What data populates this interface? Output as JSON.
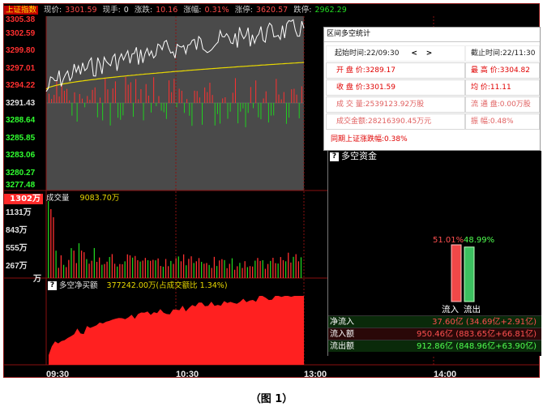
{
  "header": {
    "index_name": "上证指数",
    "now_label": "现价:",
    "now_value": "3301.59",
    "hand_label": "现手:",
    "hand_value": "0",
    "change_label": "涨跌:",
    "change_value": "10.16",
    "pct_label": "涨幅:",
    "pct_value": "0.31%",
    "limit_up_label": "涨停:",
    "limit_up_value": "3620.57",
    "limit_down_label": "跌停:",
    "limit_down_value": "2962.29"
  },
  "price_axis": [
    "3305.38",
    "3302.59",
    "3299.80",
    "3297.01",
    "3294.22",
    "3291.43",
    "3288.64",
    "3285.85",
    "3283.06",
    "3280.27",
    "3277.48"
  ],
  "volume_axis": {
    "badge": "1302万",
    "labels": [
      "1131万",
      "843万",
      "555万",
      "267万",
      "万"
    ],
    "title": "成交量",
    "value": "9083.70万"
  },
  "net_buy": {
    "title": "多空净买额",
    "value": "377242.00万(占成交额比 1.34%)"
  },
  "time_axis": [
    "09:30",
    "10:30",
    "13:00",
    "14:00"
  ],
  "stats_panel": {
    "title": "区间多空统计",
    "start_label": "起始时间:",
    "start_value": "22/09:30",
    "nav_prev": "<",
    "nav_next": ">",
    "end_label": "截止时间:",
    "end_value": "22/11:30",
    "open_label": "开 盘 价:",
    "open_value": "3289.17",
    "high_label": "最 高 价:",
    "high_value": "3304.82",
    "close_label": "收 盘 价:",
    "close_value": "3301.59",
    "avg_label": "均   价:",
    "avg_value": "11.11",
    "vol_label": "成 交 量:",
    "vol_value": "2539123.92万股",
    "float_label": "流 通 盘:",
    "float_value": "0.00万股",
    "amount_label": "成交金额:",
    "amount_value": "28216390.45万元",
    "amp_label": "振   幅:",
    "amp_value": "0.48%",
    "period_label": "同期上证涨跌幅:",
    "period_value": "0.38%"
  },
  "money_flow": {
    "title": "多空资金",
    "in_pct": "51.01%",
    "out_pct": "48.99%",
    "in_fraction": 0.5101,
    "out_fraction": 0.4899,
    "in_label": "流入",
    "out_label": "流出",
    "rows": [
      {
        "label": "净流入",
        "value": "37.60亿 (34.69亿+2.91亿)"
      },
      {
        "label": "流入额",
        "value": "950.46亿 (883.65亿+66.81亿)"
      },
      {
        "label": "流出额",
        "value": "912.86亿 (848.96亿+63.90亿)"
      }
    ],
    "colors": {
      "inflow": "#f04848",
      "outflow": "#3cc060"
    }
  },
  "caption": "（图 1）"
}
